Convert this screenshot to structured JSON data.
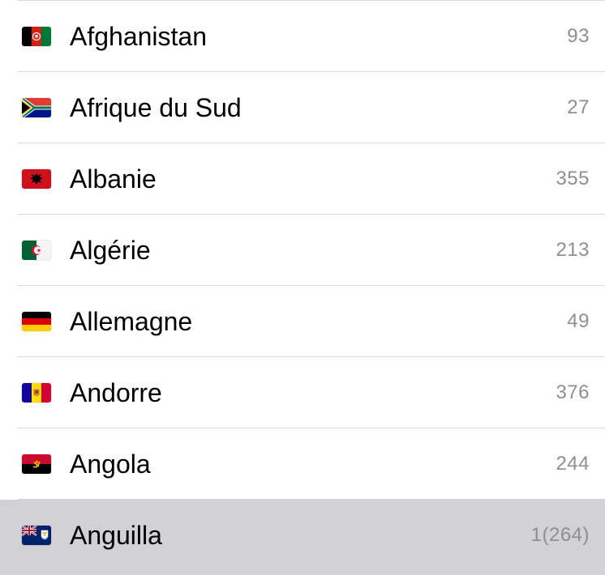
{
  "rows": [
    {
      "name": "Afghanistan",
      "count": "93",
      "flag": "flag-afghanistan-icon"
    },
    {
      "name": "Afrique du Sud",
      "count": "27",
      "flag": "flag-south-africa-icon"
    },
    {
      "name": "Albanie",
      "count": "355",
      "flag": "flag-albania-icon"
    },
    {
      "name": "Algérie",
      "count": "213",
      "flag": "flag-algeria-icon"
    },
    {
      "name": "Allemagne",
      "count": "49",
      "flag": "flag-germany-icon"
    },
    {
      "name": "Andorre",
      "count": "376",
      "flag": "flag-andorra-icon"
    },
    {
      "name": "Angola",
      "count": "244",
      "flag": "flag-angola-icon"
    },
    {
      "name": "Anguilla",
      "count": "1(264)",
      "flag": "flag-anguilla-icon",
      "selected": true
    }
  ],
  "colors": {
    "separator": "#d6d6da",
    "selected_row": "#d1d1d6",
    "count_text": "#8e8e93"
  }
}
